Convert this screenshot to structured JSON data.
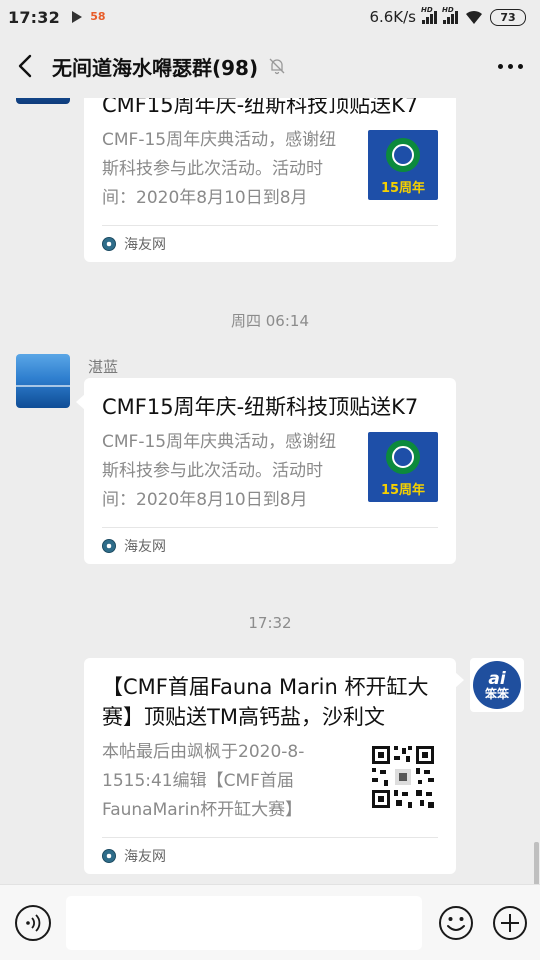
{
  "status_bar": {
    "time": "17:32",
    "app_badge": "58",
    "network_speed": "6.6K/s",
    "sim1_label": "HD",
    "sim2_label": "HD",
    "battery": "73"
  },
  "header": {
    "title": "无间道海水嘚瑟群(98)"
  },
  "messages": [
    {
      "card_title": "CMF15周年庆-纽斯科技顶贴送K7",
      "card_desc": "CMF-15周年庆典活动，感谢纽斯科技参与此次活动。活动时间：2020年8月10日到8月",
      "thumb_label": "15周年",
      "source": "海友网"
    },
    {
      "timestamp": "周四 06:14",
      "sender": "湛蓝",
      "card_title": "CMF15周年庆-纽斯科技顶贴送K7",
      "card_desc": "CMF-15周年庆典活动，感谢纽斯科技参与此次活动。活动时间：2020年8月10日到8月",
      "thumb_label": "15周年",
      "source": "海友网"
    },
    {
      "timestamp": "17:32",
      "card_title": "【CMF首届Fauna Marin 杯开缸大赛】顶贴送TM高钙盐，沙利文",
      "card_desc": "本帖最后由飒枫于2020-8-1515:41编辑【CMF首届FaunaMarin杯开缸大赛】",
      "source": "海友网",
      "avatar_text_top": "ai",
      "avatar_text_bottom": "笨笨"
    }
  ],
  "input_bar": {
    "placeholder": ""
  },
  "colors": {
    "background": "#ededed",
    "card": "#ffffff",
    "thumb_blue": "#1e4fa8",
    "thumb_text": "#f5d000"
  }
}
